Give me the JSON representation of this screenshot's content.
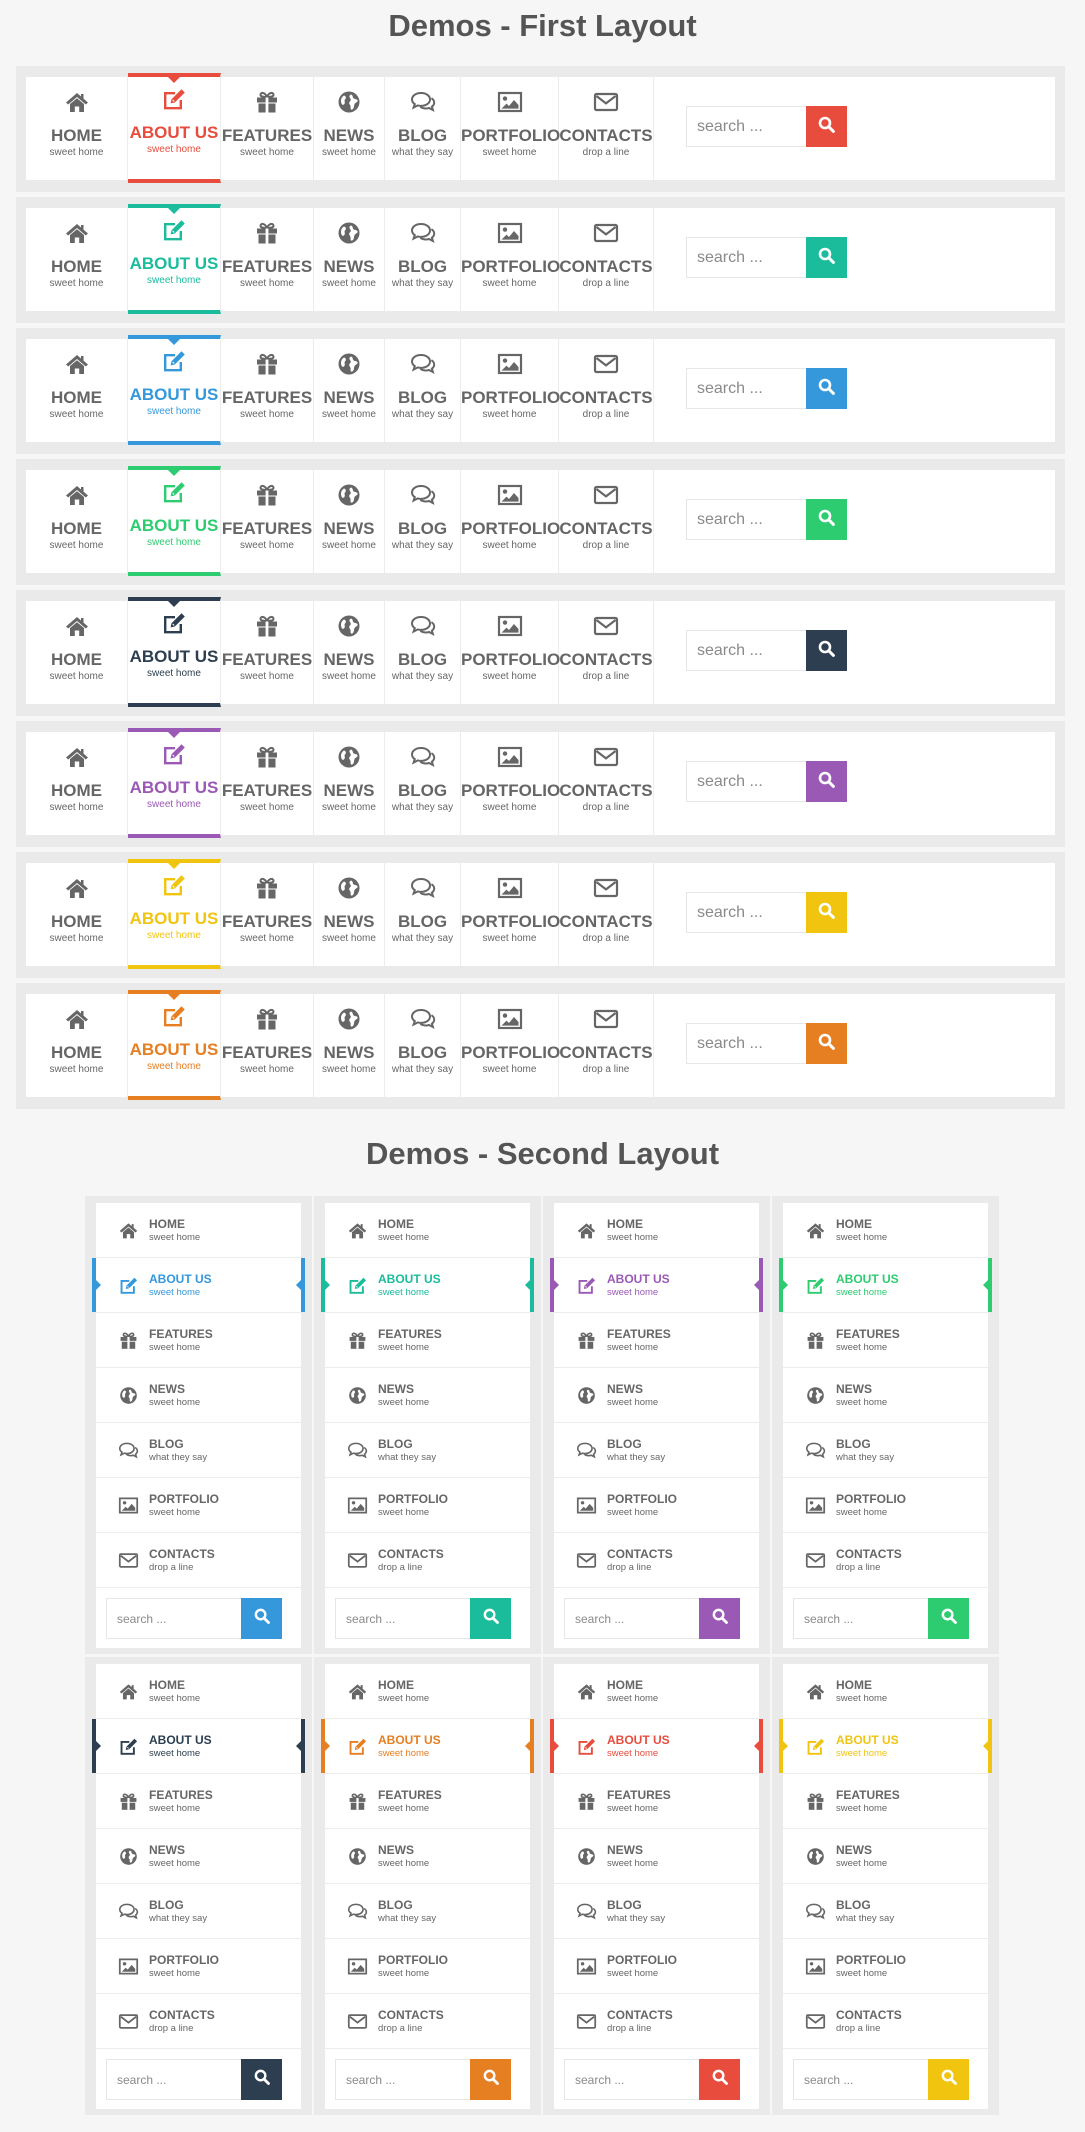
{
  "title_first": "Demos - First Layout",
  "title_second": "Demos - Second Layout",
  "search_placeholder_first": "search ...",
  "search_placeholder_second": "search ...",
  "menu": [
    {
      "icon": "home-icon",
      "label": "HOME",
      "sub": "sweet home"
    },
    {
      "icon": "edit-icon",
      "label": "ABOUT US",
      "sub": "sweet home"
    },
    {
      "icon": "gift-icon",
      "label": "FEATURES",
      "sub": "sweet home"
    },
    {
      "icon": "globe-icon",
      "label": "NEWS",
      "sub": "sweet home"
    },
    {
      "icon": "comments-icon",
      "label": "BLOG",
      "sub": "what they say"
    },
    {
      "icon": "image-icon",
      "label": "PORTFOLIO",
      "sub": "sweet home"
    },
    {
      "icon": "envelope-icon",
      "label": "CONTACTS",
      "sub": "drop a line"
    }
  ],
  "active_index": 1,
  "first_layout_colors": [
    "#e74c3c",
    "#1abc9c",
    "#3498db",
    "#2ecc71",
    "#2c3e50",
    "#9b59b6",
    "#f1c40f",
    "#e67e22"
  ],
  "second_layout_colors": [
    [
      "#3498db",
      "#1abc9c",
      "#9b59b6",
      "#2ecc71"
    ],
    [
      "#2c3e50",
      "#e67e22",
      "#e74c3c",
      "#f1c40f"
    ]
  ],
  "neutral_color": "#666666"
}
